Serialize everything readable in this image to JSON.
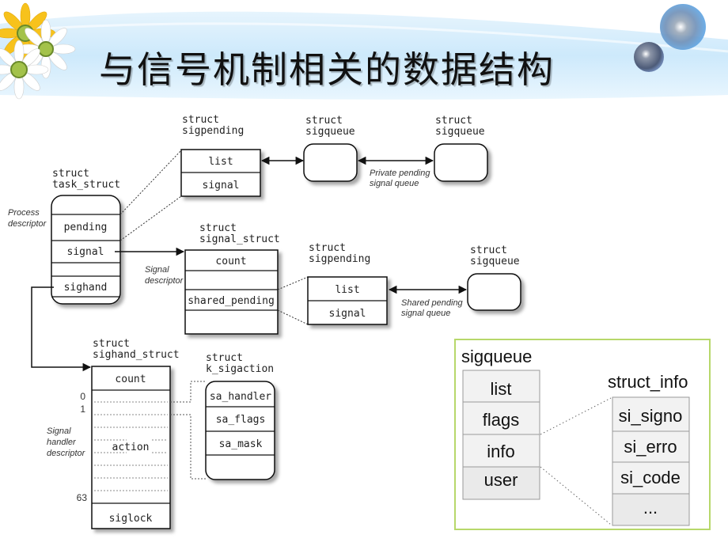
{
  "slide": {
    "title": "与信号机制相关的数据结构"
  },
  "diagram": {
    "task_struct": {
      "header": [
        "struct",
        "task_struct"
      ],
      "side_label": [
        "Process",
        "descriptor"
      ],
      "fields": [
        "",
        "pending",
        "signal",
        "",
        "sighand",
        ""
      ]
    },
    "sigpending_private": {
      "header": [
        "struct",
        "sigpending"
      ],
      "fields": [
        "list",
        "signal"
      ]
    },
    "sigqueue_private_1": {
      "header": [
        "struct",
        "sigqueue"
      ]
    },
    "sigqueue_private_2": {
      "header": [
        "struct",
        "sigqueue"
      ]
    },
    "private_queue_label": [
      "Private pending",
      "signal queue"
    ],
    "signal_struct": {
      "header": [
        "struct",
        "signal_struct"
      ],
      "side_label": [
        "Signal",
        "descriptor"
      ],
      "fields": [
        "count",
        "",
        "shared_pending",
        ""
      ]
    },
    "sigpending_shared": {
      "header": [
        "struct",
        "sigpending"
      ],
      "fields": [
        "list",
        "signal"
      ]
    },
    "sigqueue_shared": {
      "header": [
        "struct",
        "sigqueue"
      ]
    },
    "shared_queue_label": [
      "Shared pending",
      "signal queue"
    ],
    "sighand_struct": {
      "header": [
        "struct",
        "sighand_struct"
      ],
      "side_label": [
        "Signal",
        "handler",
        "descriptor"
      ],
      "fields": [
        "count",
        "action",
        "siglock"
      ],
      "index_labels": [
        "0",
        "1",
        "63"
      ]
    },
    "k_sigaction": {
      "header": [
        "struct",
        "k_sigaction"
      ],
      "fields": [
        "sa_handler",
        "sa_flags",
        "sa_mask",
        ""
      ]
    },
    "inset": {
      "sigqueue": {
        "title": "sigqueue",
        "fields": [
          "list",
          "flags",
          "info",
          "user"
        ]
      },
      "struct_info": {
        "title": "struct_info",
        "fields": [
          "si_signo",
          "si_erro",
          "si_code",
          "..."
        ]
      }
    }
  }
}
